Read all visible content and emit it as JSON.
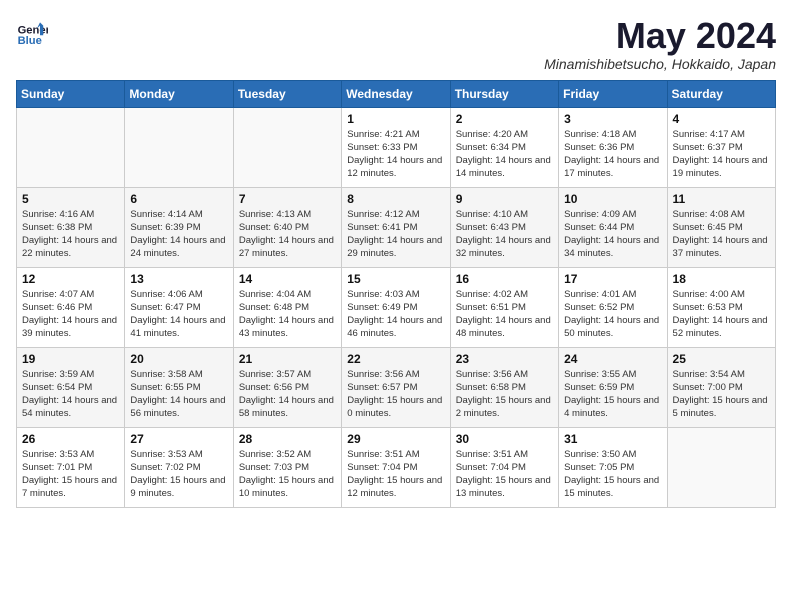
{
  "logo": {
    "general": "General",
    "blue": "Blue"
  },
  "title": "May 2024",
  "location": "Minamishibetsucho, Hokkaido, Japan",
  "weekdays": [
    "Sunday",
    "Monday",
    "Tuesday",
    "Wednesday",
    "Thursday",
    "Friday",
    "Saturday"
  ],
  "weeks": [
    [
      {
        "day": "",
        "sunrise": "",
        "sunset": "",
        "daylight": ""
      },
      {
        "day": "",
        "sunrise": "",
        "sunset": "",
        "daylight": ""
      },
      {
        "day": "",
        "sunrise": "",
        "sunset": "",
        "daylight": ""
      },
      {
        "day": "1",
        "sunrise": "Sunrise: 4:21 AM",
        "sunset": "Sunset: 6:33 PM",
        "daylight": "Daylight: 14 hours and 12 minutes."
      },
      {
        "day": "2",
        "sunrise": "Sunrise: 4:20 AM",
        "sunset": "Sunset: 6:34 PM",
        "daylight": "Daylight: 14 hours and 14 minutes."
      },
      {
        "day": "3",
        "sunrise": "Sunrise: 4:18 AM",
        "sunset": "Sunset: 6:36 PM",
        "daylight": "Daylight: 14 hours and 17 minutes."
      },
      {
        "day": "4",
        "sunrise": "Sunrise: 4:17 AM",
        "sunset": "Sunset: 6:37 PM",
        "daylight": "Daylight: 14 hours and 19 minutes."
      }
    ],
    [
      {
        "day": "5",
        "sunrise": "Sunrise: 4:16 AM",
        "sunset": "Sunset: 6:38 PM",
        "daylight": "Daylight: 14 hours and 22 minutes."
      },
      {
        "day": "6",
        "sunrise": "Sunrise: 4:14 AM",
        "sunset": "Sunset: 6:39 PM",
        "daylight": "Daylight: 14 hours and 24 minutes."
      },
      {
        "day": "7",
        "sunrise": "Sunrise: 4:13 AM",
        "sunset": "Sunset: 6:40 PM",
        "daylight": "Daylight: 14 hours and 27 minutes."
      },
      {
        "day": "8",
        "sunrise": "Sunrise: 4:12 AM",
        "sunset": "Sunset: 6:41 PM",
        "daylight": "Daylight: 14 hours and 29 minutes."
      },
      {
        "day": "9",
        "sunrise": "Sunrise: 4:10 AM",
        "sunset": "Sunset: 6:43 PM",
        "daylight": "Daylight: 14 hours and 32 minutes."
      },
      {
        "day": "10",
        "sunrise": "Sunrise: 4:09 AM",
        "sunset": "Sunset: 6:44 PM",
        "daylight": "Daylight: 14 hours and 34 minutes."
      },
      {
        "day": "11",
        "sunrise": "Sunrise: 4:08 AM",
        "sunset": "Sunset: 6:45 PM",
        "daylight": "Daylight: 14 hours and 37 minutes."
      }
    ],
    [
      {
        "day": "12",
        "sunrise": "Sunrise: 4:07 AM",
        "sunset": "Sunset: 6:46 PM",
        "daylight": "Daylight: 14 hours and 39 minutes."
      },
      {
        "day": "13",
        "sunrise": "Sunrise: 4:06 AM",
        "sunset": "Sunset: 6:47 PM",
        "daylight": "Daylight: 14 hours and 41 minutes."
      },
      {
        "day": "14",
        "sunrise": "Sunrise: 4:04 AM",
        "sunset": "Sunset: 6:48 PM",
        "daylight": "Daylight: 14 hours and 43 minutes."
      },
      {
        "day": "15",
        "sunrise": "Sunrise: 4:03 AM",
        "sunset": "Sunset: 6:49 PM",
        "daylight": "Daylight: 14 hours and 46 minutes."
      },
      {
        "day": "16",
        "sunrise": "Sunrise: 4:02 AM",
        "sunset": "Sunset: 6:51 PM",
        "daylight": "Daylight: 14 hours and 48 minutes."
      },
      {
        "day": "17",
        "sunrise": "Sunrise: 4:01 AM",
        "sunset": "Sunset: 6:52 PM",
        "daylight": "Daylight: 14 hours and 50 minutes."
      },
      {
        "day": "18",
        "sunrise": "Sunrise: 4:00 AM",
        "sunset": "Sunset: 6:53 PM",
        "daylight": "Daylight: 14 hours and 52 minutes."
      }
    ],
    [
      {
        "day": "19",
        "sunrise": "Sunrise: 3:59 AM",
        "sunset": "Sunset: 6:54 PM",
        "daylight": "Daylight: 14 hours and 54 minutes."
      },
      {
        "day": "20",
        "sunrise": "Sunrise: 3:58 AM",
        "sunset": "Sunset: 6:55 PM",
        "daylight": "Daylight: 14 hours and 56 minutes."
      },
      {
        "day": "21",
        "sunrise": "Sunrise: 3:57 AM",
        "sunset": "Sunset: 6:56 PM",
        "daylight": "Daylight: 14 hours and 58 minutes."
      },
      {
        "day": "22",
        "sunrise": "Sunrise: 3:56 AM",
        "sunset": "Sunset: 6:57 PM",
        "daylight": "Daylight: 15 hours and 0 minutes."
      },
      {
        "day": "23",
        "sunrise": "Sunrise: 3:56 AM",
        "sunset": "Sunset: 6:58 PM",
        "daylight": "Daylight: 15 hours and 2 minutes."
      },
      {
        "day": "24",
        "sunrise": "Sunrise: 3:55 AM",
        "sunset": "Sunset: 6:59 PM",
        "daylight": "Daylight: 15 hours and 4 minutes."
      },
      {
        "day": "25",
        "sunrise": "Sunrise: 3:54 AM",
        "sunset": "Sunset: 7:00 PM",
        "daylight": "Daylight: 15 hours and 5 minutes."
      }
    ],
    [
      {
        "day": "26",
        "sunrise": "Sunrise: 3:53 AM",
        "sunset": "Sunset: 7:01 PM",
        "daylight": "Daylight: 15 hours and 7 minutes."
      },
      {
        "day": "27",
        "sunrise": "Sunrise: 3:53 AM",
        "sunset": "Sunset: 7:02 PM",
        "daylight": "Daylight: 15 hours and 9 minutes."
      },
      {
        "day": "28",
        "sunrise": "Sunrise: 3:52 AM",
        "sunset": "Sunset: 7:03 PM",
        "daylight": "Daylight: 15 hours and 10 minutes."
      },
      {
        "day": "29",
        "sunrise": "Sunrise: 3:51 AM",
        "sunset": "Sunset: 7:04 PM",
        "daylight": "Daylight: 15 hours and 12 minutes."
      },
      {
        "day": "30",
        "sunrise": "Sunrise: 3:51 AM",
        "sunset": "Sunset: 7:04 PM",
        "daylight": "Daylight: 15 hours and 13 minutes."
      },
      {
        "day": "31",
        "sunrise": "Sunrise: 3:50 AM",
        "sunset": "Sunset: 7:05 PM",
        "daylight": "Daylight: 15 hours and 15 minutes."
      },
      {
        "day": "",
        "sunrise": "",
        "sunset": "",
        "daylight": ""
      }
    ]
  ]
}
